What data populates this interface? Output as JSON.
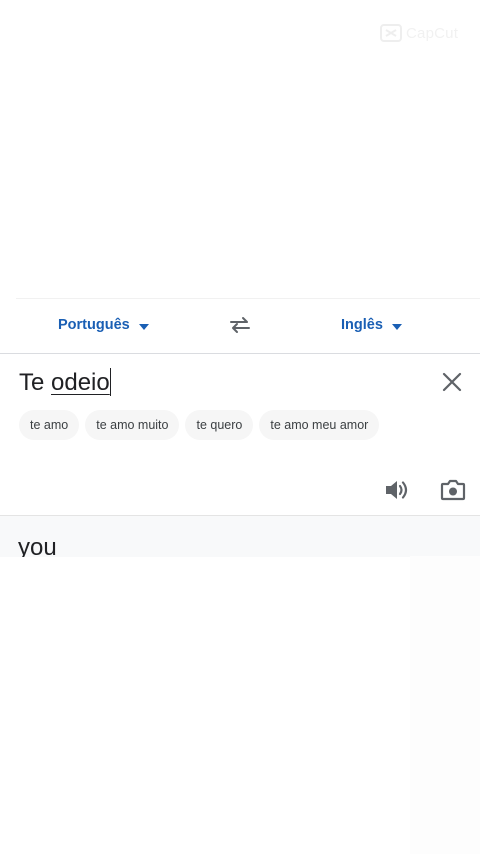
{
  "watermark": {
    "text": "CapCut"
  },
  "language_bar": {
    "source_language": "Português",
    "target_language": "Inglês",
    "swap_icon": "swap-arrows-icon",
    "dropdown_icon": "caret-down-icon"
  },
  "input": {
    "text_plain": "Te ",
    "text_underlined": "odeio",
    "clear_icon": "close-icon"
  },
  "suggestions": [
    "te amo",
    "te amo muito",
    "te quero",
    "te amo meu amor"
  ],
  "input_actions": {
    "speaker_icon": "speaker-icon",
    "camera_icon": "camera-icon"
  },
  "result": {
    "text": "you"
  },
  "colors": {
    "accent": "#1a5fb4",
    "text": "#202124",
    "chip_bg": "#f6f6f6",
    "icon": "#5f6368"
  }
}
